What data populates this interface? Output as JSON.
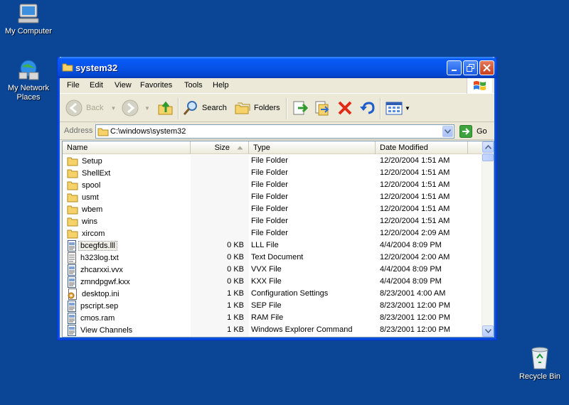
{
  "desktop": {
    "icons": [
      {
        "label": "My Computer"
      },
      {
        "label": "My Network Places"
      },
      {
        "label": "Recycle Bin"
      }
    ]
  },
  "window": {
    "title": "system32",
    "menu": [
      "File",
      "Edit",
      "View",
      "Favorites",
      "Tools",
      "Help"
    ],
    "toolbar": {
      "back": "Back",
      "search": "Search",
      "folders": "Folders"
    },
    "address": {
      "label": "Address",
      "value": "C:\\windows\\system32",
      "go": "Go"
    },
    "columns": {
      "name": "Name",
      "size": "Size",
      "type": "Type",
      "date": "Date Modified"
    },
    "files": [
      {
        "name": "Setup",
        "size": "",
        "type": "File Folder",
        "date": "12/20/2004 1:51 AM",
        "icon": "folder-icon"
      },
      {
        "name": "ShellExt",
        "size": "",
        "type": "File Folder",
        "date": "12/20/2004 1:51 AM",
        "icon": "folder-icon"
      },
      {
        "name": "spool",
        "size": "",
        "type": "File Folder",
        "date": "12/20/2004 1:51 AM",
        "icon": "folder-icon"
      },
      {
        "name": "usmt",
        "size": "",
        "type": "File Folder",
        "date": "12/20/2004 1:51 AM",
        "icon": "folder-icon"
      },
      {
        "name": "wbem",
        "size": "",
        "type": "File Folder",
        "date": "12/20/2004 1:51 AM",
        "icon": "folder-icon"
      },
      {
        "name": "wins",
        "size": "",
        "type": "File Folder",
        "date": "12/20/2004 1:51 AM",
        "icon": "folder-icon"
      },
      {
        "name": "xircom",
        "size": "",
        "type": "File Folder",
        "date": "12/20/2004 2:09 AM",
        "icon": "folder-icon"
      },
      {
        "name": "bcegfds.lll",
        "size": "0 KB",
        "type": "LLL File",
        "date": "4/4/2004 8:09 PM",
        "icon": "file-icon",
        "selected": true
      },
      {
        "name": "h323log.txt",
        "size": "0 KB",
        "type": "Text Document",
        "date": "12/20/2004 2:00 AM",
        "icon": "text-file-icon"
      },
      {
        "name": "zhcarxxi.vvx",
        "size": "0 KB",
        "type": "VVX File",
        "date": "4/4/2004 8:09 PM",
        "icon": "file-icon"
      },
      {
        "name": "zmndpgwf.kxx",
        "size": "0 KB",
        "type": "KXX File",
        "date": "4/4/2004 8:09 PM",
        "icon": "file-icon"
      },
      {
        "name": "desktop.ini",
        "size": "1 KB",
        "type": "Configuration Settings",
        "date": "8/23/2001 4:00 AM",
        "icon": "settings-file-icon"
      },
      {
        "name": "pscript.sep",
        "size": "1 KB",
        "type": "SEP File",
        "date": "8/23/2001 12:00 PM",
        "icon": "file-icon"
      },
      {
        "name": "cmos.ram",
        "size": "1 KB",
        "type": "RAM File",
        "date": "8/23/2001 12:00 PM",
        "icon": "file-icon"
      },
      {
        "name": "View Channels",
        "size": "1 KB",
        "type": "Windows Explorer Command",
        "date": "8/23/2001 12:00 PM",
        "icon": "file-icon"
      }
    ]
  }
}
